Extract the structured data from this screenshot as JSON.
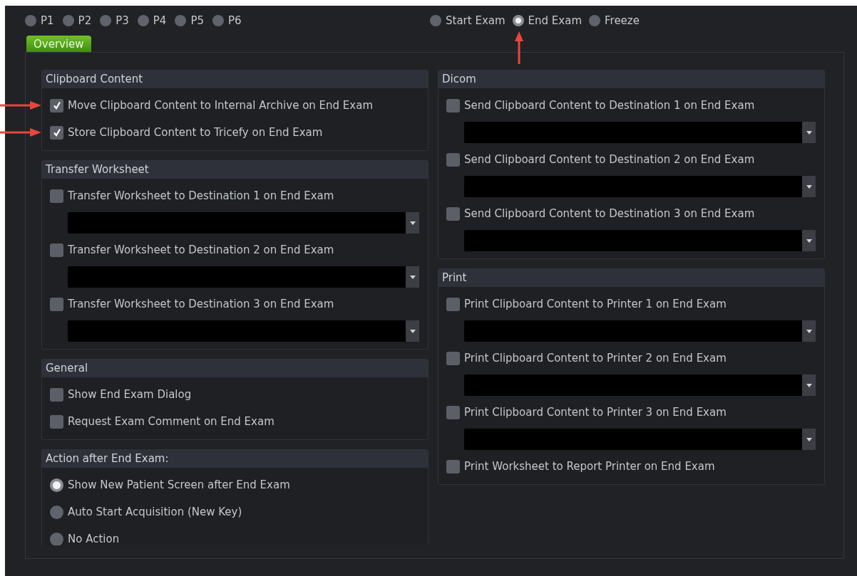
{
  "presets": [
    {
      "label": "P1",
      "selected": false
    },
    {
      "label": "P2",
      "selected": false
    },
    {
      "label": "P3",
      "selected": false
    },
    {
      "label": "P4",
      "selected": false
    },
    {
      "label": "P5",
      "selected": false
    },
    {
      "label": "P6",
      "selected": false
    }
  ],
  "triggers": [
    {
      "label": "Start Exam",
      "selected": false,
      "annotated": false
    },
    {
      "label": "End Exam",
      "selected": true,
      "annotated": true
    },
    {
      "label": "Freeze",
      "selected": false,
      "annotated": false
    }
  ],
  "tabs": [
    {
      "label": "Overview",
      "selected": true
    }
  ],
  "columns": [
    [
      {
        "title": "Clipboard Content",
        "items": [
          {
            "kind": "checkbox",
            "label": "Move Clipboard Content to Internal Archive on End Exam",
            "checked": true,
            "annotated": true
          },
          {
            "kind": "checkbox",
            "label": "Store Clipboard Content to Tricefy on End Exam",
            "checked": true,
            "annotated": true
          }
        ]
      },
      {
        "title": "Transfer Worksheet",
        "items": [
          {
            "kind": "checkbox",
            "label": "Transfer Worksheet to Destination 1 on End Exam",
            "checked": false,
            "annotated": false
          },
          {
            "kind": "dropdown"
          },
          {
            "kind": "checkbox",
            "label": "Transfer Worksheet to Destination 2 on End Exam",
            "checked": false,
            "annotated": false
          },
          {
            "kind": "dropdown"
          },
          {
            "kind": "checkbox",
            "label": "Transfer Worksheet to Destination 3 on End Exam",
            "checked": false,
            "annotated": false
          },
          {
            "kind": "dropdown"
          }
        ]
      },
      {
        "title": "General",
        "items": [
          {
            "kind": "checkbox",
            "label": "Show End Exam Dialog",
            "checked": false,
            "annotated": false
          },
          {
            "kind": "checkbox",
            "label": "Request Exam Comment on End Exam",
            "checked": false,
            "annotated": false
          }
        ]
      },
      {
        "title": "Action after End Exam:",
        "items": [
          {
            "kind": "radio",
            "label": "Show New Patient Screen after End Exam",
            "selected": true
          },
          {
            "kind": "radio",
            "label": "Auto Start Acquisition (New Key)",
            "selected": false
          },
          {
            "kind": "radio",
            "label": "No Action",
            "selected": false
          }
        ]
      }
    ],
    [
      {
        "title": "Dicom",
        "items": [
          {
            "kind": "checkbox",
            "label": "Send Clipboard Content to Destination 1 on End Exam",
            "checked": false,
            "annotated": false
          },
          {
            "kind": "dropdown"
          },
          {
            "kind": "checkbox",
            "label": "Send Clipboard Content to Destination 2 on End Exam",
            "checked": false,
            "annotated": false
          },
          {
            "kind": "dropdown"
          },
          {
            "kind": "checkbox",
            "label": "Send Clipboard Content to Destination 3 on End Exam",
            "checked": false,
            "annotated": false
          },
          {
            "kind": "dropdown"
          }
        ]
      },
      {
        "title": "Print",
        "items": [
          {
            "kind": "checkbox",
            "label": "Print Clipboard Content to Printer 1 on End Exam",
            "checked": false,
            "annotated": false
          },
          {
            "kind": "dropdown"
          },
          {
            "kind": "checkbox",
            "label": "Print Clipboard Content to Printer 2 on End Exam",
            "checked": false,
            "annotated": false
          },
          {
            "kind": "dropdown"
          },
          {
            "kind": "checkbox",
            "label": "Print Clipboard Content to Printer 3 on End Exam",
            "checked": false,
            "annotated": false
          },
          {
            "kind": "dropdown"
          },
          {
            "kind": "checkbox",
            "label": "Print Worksheet to Report Printer on End Exam",
            "checked": false,
            "annotated": false
          }
        ]
      }
    ]
  ]
}
